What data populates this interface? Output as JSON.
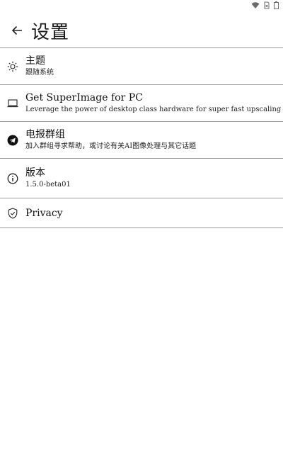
{
  "header": {
    "title": "设置",
    "back_icon": "arrow-left-icon"
  },
  "settings": [
    {
      "icon": "sun-icon",
      "title": "主题",
      "subtitle": "跟随系统"
    },
    {
      "icon": "laptop-icon",
      "title": "Get SuperImage for PC",
      "subtitle": "Leverage the power of desktop class hardware for super fast upscaling"
    },
    {
      "icon": "telegram-icon",
      "title": "电报群组",
      "subtitle": "加入群组寻求帮助，或讨论有关AI图像处理与其它话题"
    },
    {
      "icon": "info-icon",
      "title": "版本",
      "subtitle": "1.5.0-beta01"
    },
    {
      "icon": "shield-icon",
      "title": "Privacy"
    }
  ],
  "colors": {
    "divider": "#9a9a9a",
    "text": "#1b1b1b",
    "background": "#ffffff"
  }
}
